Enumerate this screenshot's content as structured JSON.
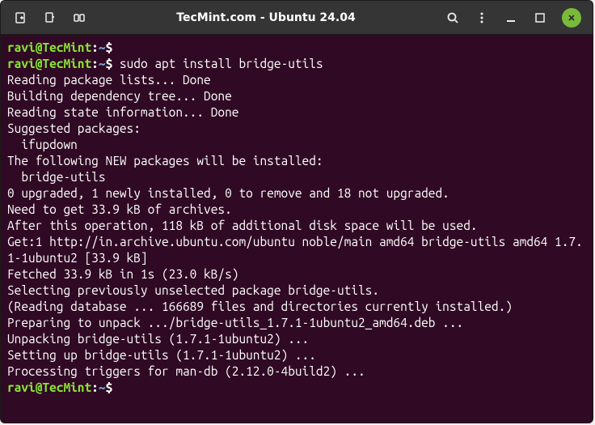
{
  "titlebar": {
    "title": "TecMint.com - Ubuntu 24.04"
  },
  "prompt": {
    "user_host": "ravi@TecMint",
    "sep": ":",
    "path": "~",
    "symbol": "$"
  },
  "commands": {
    "cmd1": "sudo apt install bridge-utils"
  },
  "output": {
    "l1": "Reading package lists... Done",
    "l2": "Building dependency tree... Done",
    "l3": "Reading state information... Done",
    "l4": "Suggested packages:",
    "l5": "  ifupdown",
    "l6": "The following NEW packages will be installed:",
    "l7": "  bridge-utils",
    "l8": "0 upgraded, 1 newly installed, 0 to remove and 18 not upgraded.",
    "l9": "Need to get 33.9 kB of archives.",
    "l10": "After this operation, 118 kB of additional disk space will be used.",
    "l11": "Get:1 http://in.archive.ubuntu.com/ubuntu noble/main amd64 bridge-utils amd64 1.7.1-1ubuntu2 [33.9 kB]",
    "l12": "Fetched 33.9 kB in 1s (23.0 kB/s)",
    "l13": "Selecting previously unselected package bridge-utils.",
    "l14": "(Reading database ... 166689 files and directories currently installed.)",
    "l15": "Preparing to unpack .../bridge-utils_1.7.1-1ubuntu2_amd64.deb ...",
    "l16": "Unpacking bridge-utils (1.7.1-1ubuntu2) ...",
    "l17": "Setting up bridge-utils (1.7.1-1ubuntu2) ...",
    "l18": "Processing triggers for man-db (2.12.0-4build2) ..."
  }
}
